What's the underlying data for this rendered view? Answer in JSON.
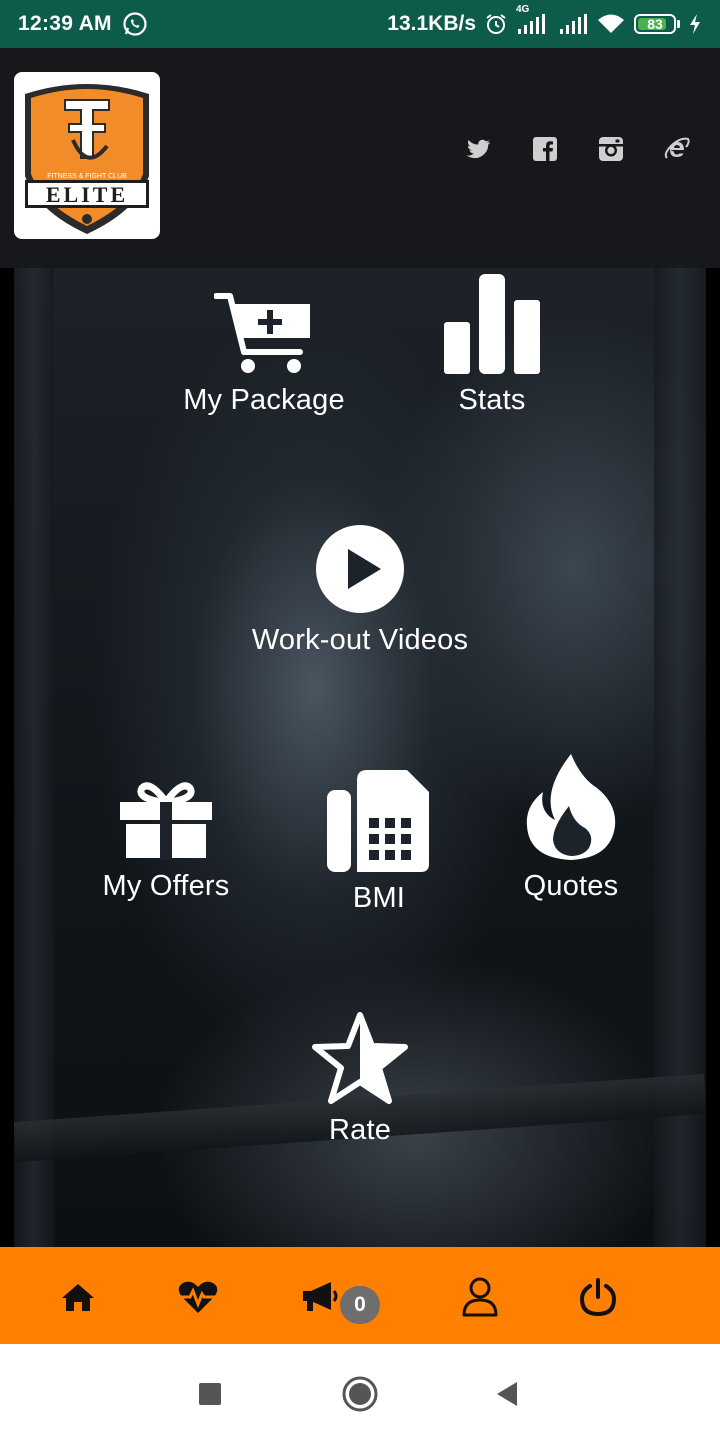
{
  "status_bar": {
    "time": "12:39 AM",
    "speed": "13.1KB/s",
    "network_label": "4G",
    "battery": "83",
    "icons": [
      "whatsapp-icon",
      "alarm-icon",
      "signal-icon",
      "wifi-icon",
      "battery-icon",
      "charging-icon"
    ]
  },
  "header": {
    "logo": {
      "top_text": "FITNESS & FIGHT CLUB",
      "brand": "ELITE",
      "colors": {
        "shield": "#f28c28",
        "outline": "#222222"
      }
    },
    "social": [
      "twitter-icon",
      "facebook-icon",
      "instagram-icon",
      "internet-explorer-icon"
    ]
  },
  "menu": {
    "my_package": "My Package",
    "stats": "Stats",
    "workout_videos": "Work-out Videos",
    "my_offers": "My Offers",
    "bmi": "BMI",
    "quotes": "Quotes",
    "rate": "Rate"
  },
  "bottom_nav": {
    "items": [
      "home-icon",
      "heart-pulse-icon",
      "megaphone-icon",
      "user-icon",
      "power-icon"
    ],
    "notification_count": "0",
    "background": "#ff7f00"
  },
  "system_nav": [
    "recents-button",
    "home-button",
    "back-button"
  ]
}
